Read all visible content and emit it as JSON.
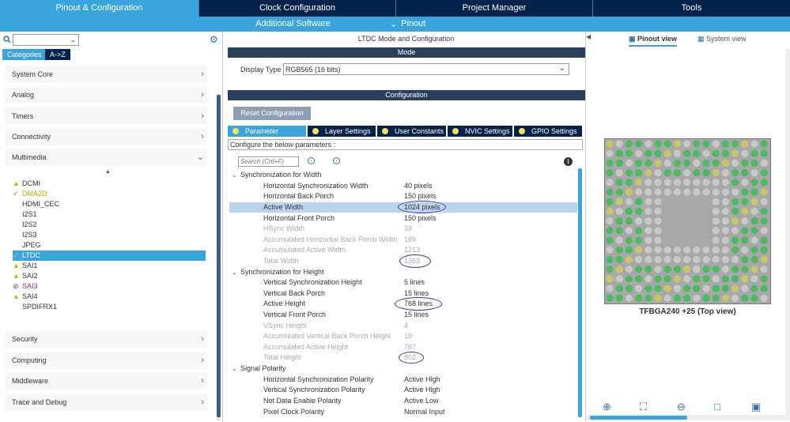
{
  "top_tabs": [
    {
      "label": "Pinout & Configuration",
      "active": true
    },
    {
      "label": "Clock Configuration"
    },
    {
      "label": "Project Manager"
    },
    {
      "label": "Tools"
    }
  ],
  "sub_bar": {
    "additional": "Additional Software",
    "pinout": "Pinout"
  },
  "left": {
    "category_tab": "Categories",
    "az_tab": "A->Z",
    "categories_top": [
      "System Core",
      "Analog",
      "Timers",
      "Connectivity",
      "Multimedia"
    ],
    "ip_items": [
      {
        "label": "DCMI",
        "status": "warning"
      },
      {
        "label": "DMA2D",
        "status": "ok"
      },
      {
        "label": "HDMI_CEC",
        "status": "none"
      },
      {
        "label": "I2S1",
        "status": "none"
      },
      {
        "label": "I2S2",
        "status": "none"
      },
      {
        "label": "I2S3",
        "status": "none"
      },
      {
        "label": "JPEG",
        "status": "none"
      },
      {
        "label": "LTDC",
        "status": "ok-selected"
      },
      {
        "label": "SAI1",
        "status": "warning"
      },
      {
        "label": "SAI2",
        "status": "warning"
      },
      {
        "label": "SAI3",
        "status": "disabled"
      },
      {
        "label": "SAI4",
        "status": "warning"
      },
      {
        "label": "SPDIFRX1",
        "status": "none"
      }
    ],
    "categories_bottom": [
      "Security",
      "Computing",
      "Middleware",
      "Trace and Debug"
    ]
  },
  "mid": {
    "title": "LTDC Mode and Configuration",
    "mode_header": "Mode",
    "display_type_label": "Display Type",
    "display_type_value": "RGB565 (16 bits)",
    "config_header": "Configuration",
    "reset_button": "Reset Configuration",
    "tabs": [
      "Parameter Settings",
      "Layer Settings",
      "User Constants",
      "NVIC Settings",
      "GPIO Settings"
    ],
    "hint": "Configure the below parameters :",
    "search_placeholder": "Search (Crtl+F)",
    "groups": [
      {
        "name": "Synchronization for Width",
        "params": [
          {
            "name": "Horizontal Synchronization Width",
            "value": "40 pixels"
          },
          {
            "name": "Horizontal Back Porch",
            "value": "150 pixels"
          },
          {
            "name": "Active Width",
            "value": "1024 pixels",
            "selected": true
          },
          {
            "name": "Horizontal Front Porch",
            "value": "150 pixels"
          },
          {
            "name": "HSync Width",
            "value": "39",
            "dim": true
          },
          {
            "name": "Accumulated Horizontal Back Porch Width",
            "value": "189",
            "dim": true
          },
          {
            "name": "Accumulated Active Width",
            "value": "1213",
            "dim": true
          },
          {
            "name": "Total Width",
            "value": "1363",
            "dim": true
          }
        ]
      },
      {
        "name": "Synchronization for Height",
        "params": [
          {
            "name": "Vertical Synchronization Height",
            "value": "5 lines"
          },
          {
            "name": "Vertical Back Porch",
            "value": "15 lines"
          },
          {
            "name": "Active Height",
            "value": "768 lines"
          },
          {
            "name": "Vertical Front Porch",
            "value": "15 lines"
          },
          {
            "name": "VSync Height",
            "value": "4",
            "dim": true
          },
          {
            "name": "Accumulated Vertical Back Porch Height",
            "value": "19",
            "dim": true
          },
          {
            "name": "Accumulated Active Height",
            "value": "787",
            "dim": true
          },
          {
            "name": "Total Height",
            "value": "802",
            "dim": true
          }
        ]
      },
      {
        "name": "Signal Polarity",
        "params": [
          {
            "name": "Horizontal Synchronization Polarity",
            "value": "Active High"
          },
          {
            "name": "Vertical Synchronization Polarity",
            "value": "Active High"
          },
          {
            "name": "Not Data Enable Polarity",
            "value": "Active Low"
          },
          {
            "name": "Pixel Clock Polarity",
            "value": "Normal Input"
          }
        ]
      }
    ]
  },
  "right": {
    "pinout_view": "Pinout view",
    "system_view": "System view",
    "chip_label": "TFBGA240 +25 (Top view)"
  },
  "colors": {
    "navy": "#03234b",
    "accent": "#3aa5dc",
    "pin_green": "#4cb963",
    "pin_grey": "#c8c8c8",
    "pin_yellow": "#c9c66a"
  }
}
